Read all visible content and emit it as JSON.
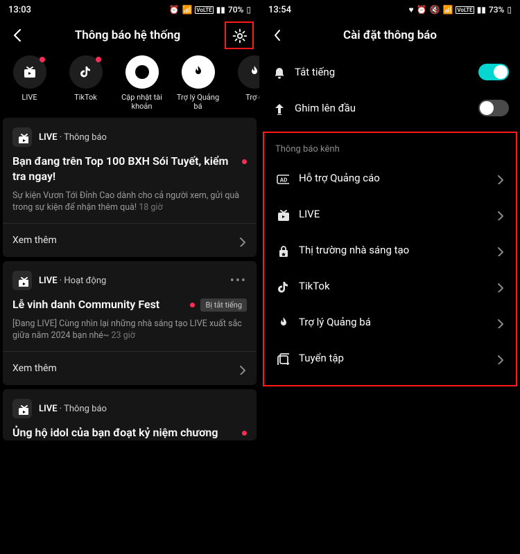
{
  "left": {
    "status": {
      "time": "13:03",
      "battery": "70%"
    },
    "header": {
      "title": "Thông báo hệ thống"
    },
    "channels": [
      {
        "icon": "live",
        "label": "LIVE",
        "dot": true
      },
      {
        "icon": "tiktok",
        "label": "TikTok",
        "dot": true
      },
      {
        "icon": "upload",
        "label": "Cập nhật tài khoản",
        "white": true
      },
      {
        "icon": "flame",
        "label": "Trợ lý Quảng bá",
        "white": true
      },
      {
        "icon": "star",
        "label": "Trợ c",
        "partial": true
      }
    ],
    "cards": [
      {
        "source_prefix": "LIVE",
        "source_suffix": "Thông báo",
        "title": "Bạn đang trên Top 100 BXH Sói Tuyết, kiểm tra ngay!",
        "dot": true,
        "desc": "Sự kiện Vươn Tới Đỉnh Cao dành cho cả người xem, gửi quà trong sự kiện để nhận thêm quà!",
        "time": "18 giờ",
        "foot": "Xem thêm"
      },
      {
        "source_prefix": "LIVE",
        "source_suffix": "Hoạt động",
        "more": true,
        "title": "Lễ vinh danh Community Fest",
        "dot": true,
        "muted_badge": "Bị tắt tiếng",
        "desc": "[Đang LIVE] Cùng nhìn lại những nhà sáng tạo LIVE xuất sắc giữa năm 2024 bạn nhé~",
        "time": "23 giờ",
        "foot": "Xem thêm"
      },
      {
        "source_prefix": "LIVE",
        "source_suffix": "Thông báo",
        "title": "Ủng hộ idol của bạn đoạt kỷ niệm chương",
        "dot": true
      }
    ]
  },
  "right": {
    "status": {
      "time": "13:54",
      "battery": "73%"
    },
    "header": {
      "title": "Cài đặt thông báo"
    },
    "toggles": {
      "mute_label": "Tắt tiếng",
      "mute_on": true,
      "pin_label": "Ghim lên đầu",
      "pin_on": false
    },
    "section_label": "Thông báo kênh",
    "channel_settings": [
      {
        "icon": "ad",
        "label": "Hỗ trợ Quảng cáo"
      },
      {
        "icon": "live",
        "label": "LIVE"
      },
      {
        "icon": "lock",
        "label": "Thị trường nhà sáng tạo"
      },
      {
        "icon": "tiktok",
        "label": "TikTok"
      },
      {
        "icon": "flame",
        "label": "Trợ lý Quảng bá"
      },
      {
        "icon": "collect",
        "label": "Tuyển tập"
      }
    ]
  }
}
